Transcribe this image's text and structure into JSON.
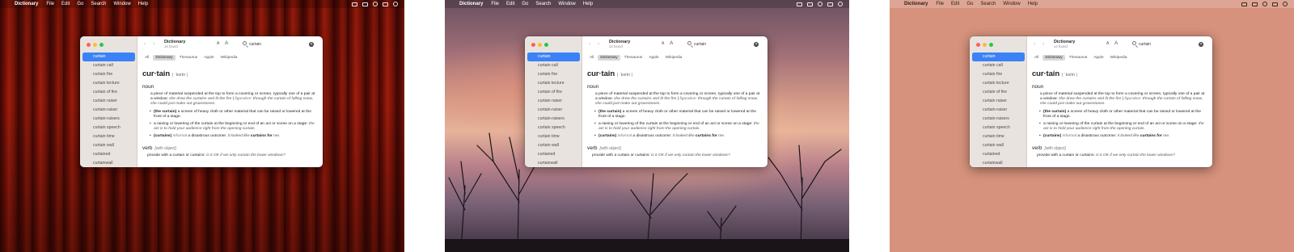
{
  "menubar": {
    "app_name": "Dictionary",
    "items": [
      "File",
      "Edit",
      "Go",
      "Search",
      "Window",
      "Help"
    ]
  },
  "window": {
    "title": "Dictionary",
    "subtitle": "14 found",
    "font_small_label": "A",
    "font_large_label": "A",
    "search_value": "curtain",
    "clear_glyph": "✕"
  },
  "sidebar": {
    "items": [
      "curtain",
      "curtain call",
      "curtain fire",
      "curtain lecture",
      "curtain of fire",
      "curtain raiser",
      "curtain-raiser",
      "curtain-raisers",
      "curtain speech",
      "curtain time",
      "curtain wall",
      "curtained",
      "curtainwall"
    ],
    "selected_index": 0
  },
  "tabs": [
    "All",
    "Dictionary",
    "Thesaurus",
    "Apple",
    "Wikipedia"
  ],
  "active_tab": "Dictionary",
  "entry": {
    "headword": "cur·tain",
    "pronunciation": "| ˈkərtn |",
    "noun_label": "noun",
    "sense1_text": "a piece of material suspended at the top to form a covering or screen, typically one of a pair at a window:",
    "sense1_example1": "she drew the curtains and lit the fire",
    "sense1_sep": " | ",
    "sense1_fig_label": "figurative",
    "sense1_example2": ": through the curtain of falling snow, she could just make out gravestones.",
    "sub1_bold": "(the curtain)",
    "sub1_text": " a screen of heavy cloth or other material that can be raised or lowered at the front of a stage.",
    "sub2_text": "a raising or lowering of the curtain at the beginning or end of an act or scene on a stage:",
    "sub2_example": " the act is to hold your audience right from the opening curtain.",
    "sub3_bold": "(curtains)",
    "sub3_label": " informal",
    "sub3_text": " a disastrous outcome:",
    "sub3_example_pre": " it looked like ",
    "sub3_example_bold": "curtains for",
    "sub3_example_post": " me.",
    "verb_label": "verb",
    "verb_note": "[with object]",
    "verb_text": "provide with a curtain or curtains:",
    "verb_example": " is it OK if we only curtain the lower windows?"
  }
}
